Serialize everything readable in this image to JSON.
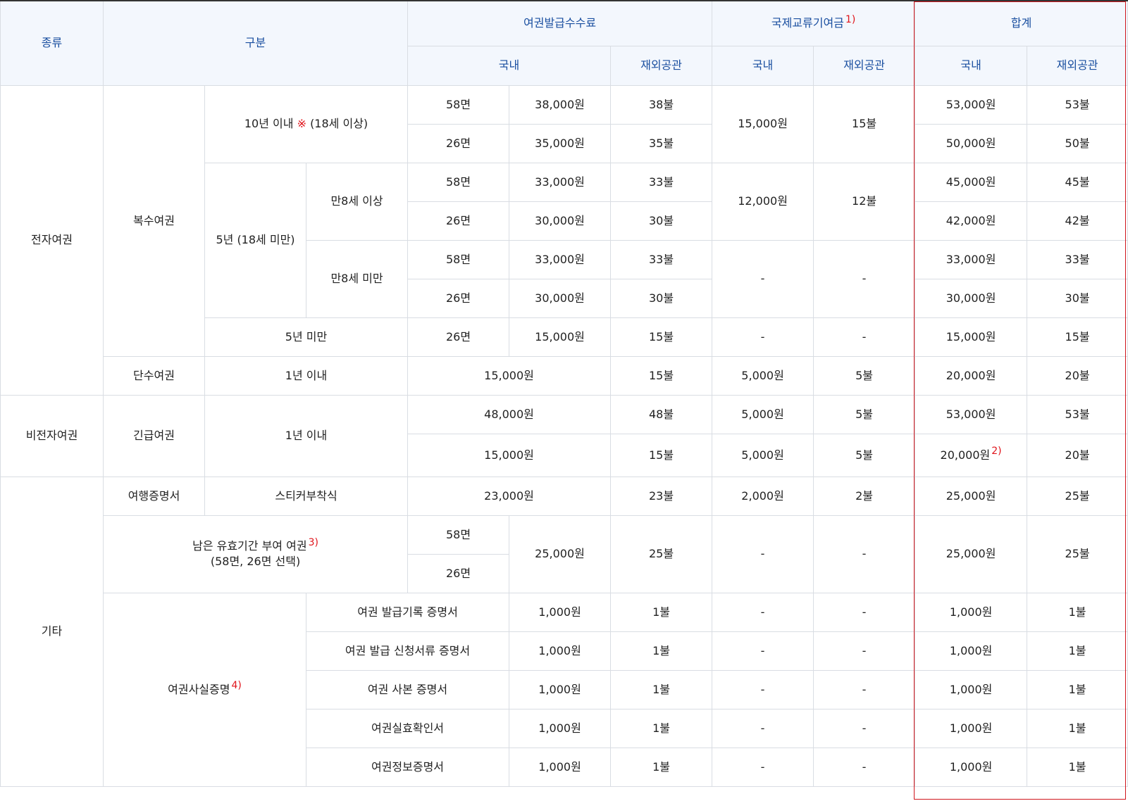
{
  "header": {
    "type": "종류",
    "category": "구분",
    "issuance_fee": "여권발급수수료",
    "intl_fund": "국제교류기여금",
    "intl_fund_note": "1)",
    "total": "합계",
    "domestic": "국내",
    "overseas": "재외공관"
  },
  "groups": {
    "electronic": "전자여권",
    "non_electronic": "비전자여권",
    "other": "기타"
  },
  "multiple_passport": {
    "label": "복수여권",
    "ten_year_label": "10년 이내",
    "ten_year_mark": "※",
    "ten_year_age": "(18세 이상)",
    "five_year_label": "5년 (18세 미만)",
    "age8_over": "만8세 이상",
    "age8_under": "만8세 미만",
    "under_five_label": "5년 미만",
    "rows": [
      {
        "pages": "58면",
        "fee_dom": "38,000원",
        "fee_ovs": "38불",
        "total_dom": "53,000원",
        "total_ovs": "53불"
      },
      {
        "pages": "26면",
        "fee_dom": "35,000원",
        "fee_ovs": "35불",
        "total_dom": "50,000원",
        "total_ovs": "50불"
      },
      {
        "pages": "58면",
        "fee_dom": "33,000원",
        "fee_ovs": "33불",
        "total_dom": "45,000원",
        "total_ovs": "45불"
      },
      {
        "pages": "26면",
        "fee_dom": "30,000원",
        "fee_ovs": "30불",
        "total_dom": "42,000원",
        "total_ovs": "42불"
      },
      {
        "pages": "58면",
        "fee_dom": "33,000원",
        "fee_ovs": "33불",
        "total_dom": "33,000원",
        "total_ovs": "33불"
      },
      {
        "pages": "26면",
        "fee_dom": "30,000원",
        "fee_ovs": "30불",
        "total_dom": "30,000원",
        "total_ovs": "30불"
      },
      {
        "pages": "26면",
        "fee_dom": "15,000원",
        "fee_ovs": "15불",
        "total_dom": "15,000원",
        "total_ovs": "15불"
      }
    ],
    "fund": [
      {
        "dom": "15,000원",
        "ovs": "15불"
      },
      {
        "dom": "12,000원",
        "ovs": "12불"
      },
      {
        "dom": "-",
        "ovs": "-"
      },
      {
        "dom": "-",
        "ovs": "-"
      }
    ]
  },
  "single_passport": {
    "label": "단수여권",
    "period": "1년 이내",
    "fee_dom": "15,000원",
    "fee_ovs": "15불",
    "fund_dom": "5,000원",
    "fund_ovs": "5불",
    "total_dom": "20,000원",
    "total_ovs": "20불"
  },
  "emergency_passport": {
    "label": "긴급여권",
    "period": "1년 이내",
    "rows": [
      {
        "fee_dom": "48,000원",
        "fee_ovs": "48불",
        "fund_dom": "5,000원",
        "fund_ovs": "5불",
        "total_dom": "53,000원",
        "total_ovs": "53불",
        "note": ""
      },
      {
        "fee_dom": "15,000원",
        "fee_ovs": "15불",
        "fund_dom": "5,000원",
        "fund_ovs": "5불",
        "total_dom": "20,000원",
        "total_ovs": "20불",
        "note": "2)"
      }
    ]
  },
  "travel_certificate": {
    "label": "여행증명서",
    "method": "스티커부착식",
    "fee_dom": "23,000원",
    "fee_ovs": "23불",
    "fund_dom": "2,000원",
    "fund_ovs": "2불",
    "total_dom": "25,000원",
    "total_ovs": "25불"
  },
  "remaining_validity": {
    "label_line1": "남은 유효기간 부여 여권",
    "note": "3)",
    "label_line2": "(58면, 26면 선택)",
    "pages_a": "58면",
    "pages_b": "26면",
    "fee_dom": "25,000원",
    "fee_ovs": "25불",
    "fund_dom": "-",
    "fund_ovs": "-",
    "total_dom": "25,000원",
    "total_ovs": "25불"
  },
  "passport_fact_cert": {
    "label": "여권사실증명",
    "note": "4)",
    "rows": [
      {
        "name": "여권 발급기록 증명서",
        "fee_dom": "1,000원",
        "fee_ovs": "1불",
        "fund_dom": "-",
        "fund_ovs": "-",
        "total_dom": "1,000원",
        "total_ovs": "1불"
      },
      {
        "name": "여권 발급 신청서류 증명서",
        "fee_dom": "1,000원",
        "fee_ovs": "1불",
        "fund_dom": "-",
        "fund_ovs": "-",
        "total_dom": "1,000원",
        "total_ovs": "1불"
      },
      {
        "name": "여권 사본 증명서",
        "fee_dom": "1,000원",
        "fee_ovs": "1불",
        "fund_dom": "-",
        "fund_ovs": "-",
        "total_dom": "1,000원",
        "total_ovs": "1불"
      },
      {
        "name": "여권실효확인서",
        "fee_dom": "1,000원",
        "fee_ovs": "1불",
        "fund_dom": "-",
        "fund_ovs": "-",
        "total_dom": "1,000원",
        "total_ovs": "1불"
      },
      {
        "name": "여권정보증명서",
        "fee_dom": "1,000원",
        "fee_ovs": "1불",
        "fund_dom": "-",
        "fund_ovs": "-",
        "total_dom": "1,000원",
        "total_ovs": "1불"
      }
    ]
  }
}
